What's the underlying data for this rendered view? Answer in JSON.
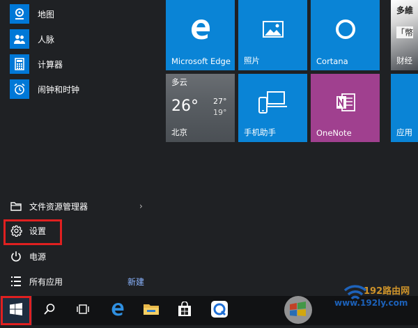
{
  "apps": [
    {
      "label": "地图",
      "icon": "map-pin-icon"
    },
    {
      "label": "人脉",
      "icon": "people-icon"
    },
    {
      "label": "计算器",
      "icon": "calculator-icon"
    },
    {
      "label": "闹钟和时钟",
      "icon": "alarm-clock-icon"
    }
  ],
  "system": {
    "file_explorer": "文件资源管理器",
    "settings": "设置",
    "power": "电源",
    "all_apps": "所有应用",
    "new_badge": "新建"
  },
  "tiles": {
    "edge": "Microsoft Edge",
    "photos": "照片",
    "cortana": "Cortana",
    "news_headline": "多維",
    "news_sub": "「幣",
    "news_label": "财经",
    "weather": {
      "condition": "多云",
      "temp": "26°",
      "high": "27°",
      "low": "19°",
      "city": "北京"
    },
    "phone": "手机助手",
    "onenote": "OneNote",
    "apps_tile": "应用"
  },
  "watermark": {
    "brand": "192路由网",
    "url": "www.192ly.com"
  },
  "colors": {
    "tile_blue": "#0a84d6",
    "onenote_purple": "#a0408f",
    "highlight_red": "#e02020"
  }
}
